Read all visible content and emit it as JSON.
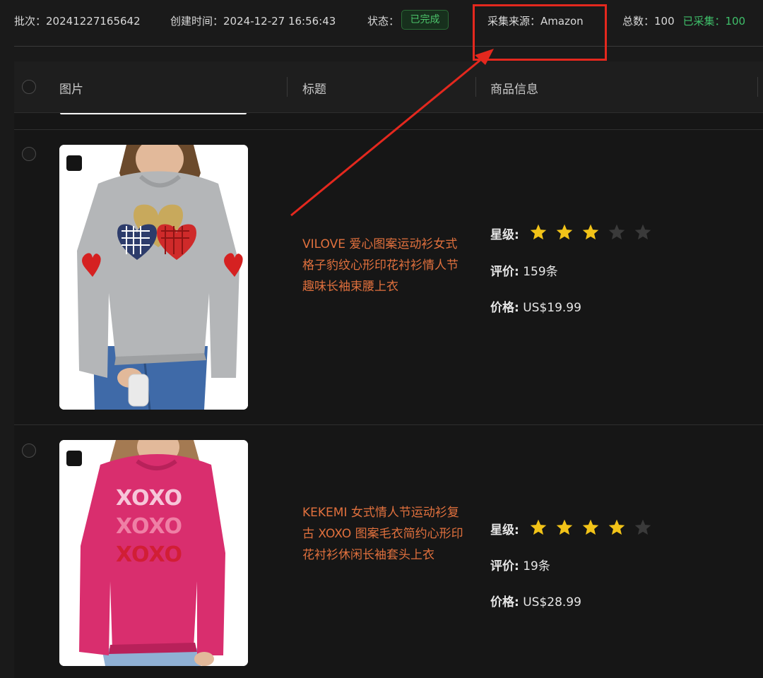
{
  "header": {
    "batch_label": "批次：",
    "batch_value": "20241227165642",
    "created_label": "创建时间：",
    "created_value": "2024-12-27 16:56:43",
    "status_label": "状态：",
    "status_value": "已完成",
    "source_label": "采集来源：",
    "source_value": "Amazon",
    "total_label": "总数：",
    "total_value": "100",
    "collected_label": "已采集：",
    "collected_value": "100"
  },
  "table": {
    "columns": [
      "图片",
      "标题",
      "商品信息"
    ]
  },
  "rows": [
    {
      "title": "VILOVE 爱心图案运动衫女式格子豹纹心形印花衬衫情人节趣味长袖束腰上衣",
      "rating_label": "星级:",
      "rating": 3,
      "rating_max": 5,
      "reviews_label": "评价:",
      "reviews_value": "159条",
      "price_label": "价格:",
      "price_value": "US$19.99"
    },
    {
      "title": "KEKEMI 女式情人节运动衫复古 XOXO 图案毛衣简约心形印花衬衫休闲长袖套头上衣",
      "rating_label": "星级:",
      "rating": 4,
      "rating_max": 5,
      "reviews_label": "评价:",
      "reviews_value": "19条",
      "price_label": "价格:",
      "price_value": "US$28.99",
      "image_text": "XOXO"
    }
  ],
  "colors": {
    "background": "#1a1a1a",
    "title_link": "#e0703d",
    "status_green": "#4cc26a",
    "collected_green": "#3fbf6a",
    "star_filled": "#f2c318",
    "star_empty": "#3a3a3a",
    "annotation_red": "#e4281e"
  },
  "icons": {
    "star": "star-icon",
    "checkbox": "checkbox-icon"
  }
}
